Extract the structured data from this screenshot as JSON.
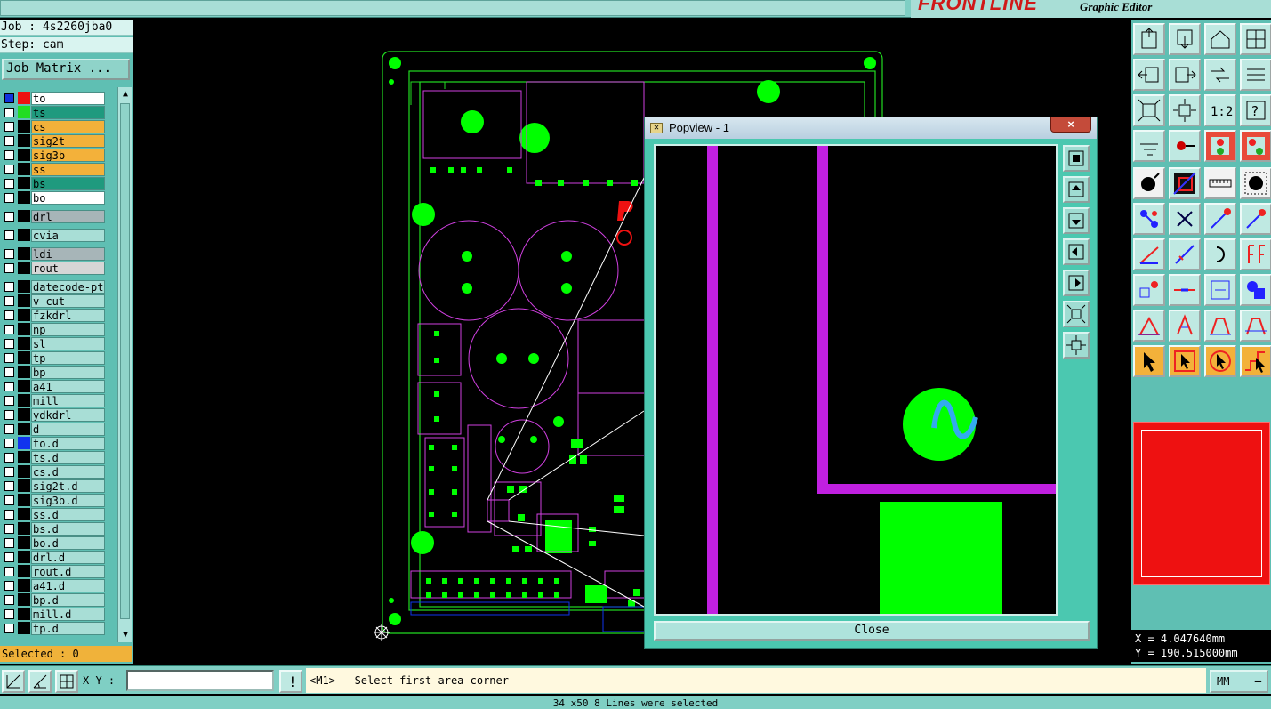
{
  "brand": {
    "logo": "FRONTLINE",
    "subtitle": "Graphic Editor"
  },
  "job": {
    "job_label": "Job : 4s2260jba0",
    "step_label": "Step: cam",
    "job_matrix": "Job Matrix ..."
  },
  "layers": [
    {
      "name": "to",
      "color": "#ffffff",
      "swatch": "#ee1111",
      "cb": "#1133dd"
    },
    {
      "name": "ts",
      "color": "#1f9a7e",
      "swatch": "#22dd22"
    },
    {
      "name": "cs",
      "color": "#f3b13a",
      "swatch": "#000000"
    },
    {
      "name": "sig2t",
      "color": "#f3b13a",
      "swatch": "#000000"
    },
    {
      "name": "sig3b",
      "color": "#f3b13a",
      "swatch": "#000000"
    },
    {
      "name": "ss",
      "color": "#f3b13a",
      "swatch": "#000000"
    },
    {
      "name": "bs",
      "color": "#1f9a7e",
      "swatch": "#000000"
    },
    {
      "name": "bo",
      "color": "#ffffff",
      "swatch": "#000000"
    },
    {
      "name": "drl",
      "color": "#a7b5b8",
      "swatch": "#000000",
      "gap": true
    },
    {
      "name": "cvia",
      "color": "#a8ded6",
      "swatch": "#000000",
      "gap": true
    },
    {
      "name": "ldi",
      "color": "#a7b5b8",
      "swatch": "#000000",
      "gap": true
    },
    {
      "name": "rout",
      "color": "#d6d6d6",
      "swatch": "#000000"
    },
    {
      "name": "datecode-pte",
      "color": "#a8ded6",
      "swatch": "#000000",
      "gap": true
    },
    {
      "name": "v-cut",
      "color": "#a8ded6",
      "swatch": "#000000"
    },
    {
      "name": "fzkdrl",
      "color": "#a8ded6",
      "swatch": "#000000"
    },
    {
      "name": "np",
      "color": "#a8ded6",
      "swatch": "#000000"
    },
    {
      "name": "sl",
      "color": "#a8ded6",
      "swatch": "#000000"
    },
    {
      "name": "tp",
      "color": "#a8ded6",
      "swatch": "#000000"
    },
    {
      "name": "bp",
      "color": "#a8ded6",
      "swatch": "#000000"
    },
    {
      "name": "a41",
      "color": "#a8ded6",
      "swatch": "#000000"
    },
    {
      "name": "mill",
      "color": "#a8ded6",
      "swatch": "#000000"
    },
    {
      "name": "ydkdrl",
      "color": "#a8ded6",
      "swatch": "#000000"
    },
    {
      "name": "d",
      "color": "#a8ded6",
      "swatch": "#000000"
    },
    {
      "name": "to.d",
      "color": "#a8ded6",
      "swatch": "#1133ee"
    },
    {
      "name": "ts.d",
      "color": "#a8ded6",
      "swatch": "#000000"
    },
    {
      "name": "cs.d",
      "color": "#a8ded6",
      "swatch": "#000000"
    },
    {
      "name": "sig2t.d",
      "color": "#a8ded6",
      "swatch": "#000000"
    },
    {
      "name": "sig3b.d",
      "color": "#a8ded6",
      "swatch": "#000000"
    },
    {
      "name": "ss.d",
      "color": "#a8ded6",
      "swatch": "#000000"
    },
    {
      "name": "bs.d",
      "color": "#a8ded6",
      "swatch": "#000000"
    },
    {
      "name": "bo.d",
      "color": "#a8ded6",
      "swatch": "#000000"
    },
    {
      "name": "drl.d",
      "color": "#a8ded6",
      "swatch": "#000000"
    },
    {
      "name": "rout.d",
      "color": "#a8ded6",
      "swatch": "#000000"
    },
    {
      "name": "a41.d",
      "color": "#a8ded6",
      "swatch": "#000000"
    },
    {
      "name": "bp.d",
      "color": "#a8ded6",
      "swatch": "#000000"
    },
    {
      "name": "mill.d",
      "color": "#a8ded6",
      "swatch": "#000000"
    },
    {
      "name": "tp.d",
      "color": "#a8ded6",
      "swatch": "#000000"
    }
  ],
  "selected": "Selected : 0",
  "popview": {
    "title": "Popview - 1",
    "close_x": "×",
    "close_label": "Close"
  },
  "coords": {
    "x": "X = 4.047640mm",
    "y": "Y = 190.515000mm"
  },
  "bottom": {
    "xy_label": "X Y :",
    "xy_value": "",
    "message": "<M1> - Select first area corner",
    "units": "MM"
  },
  "status": "34 x50 8 Lines were selected",
  "colors": {
    "pad": "#00ff00",
    "silk": "#d040e0",
    "outline": "#22dd22",
    "trace_blue": "#1133ee",
    "toolbar": "#5fbfb3"
  }
}
